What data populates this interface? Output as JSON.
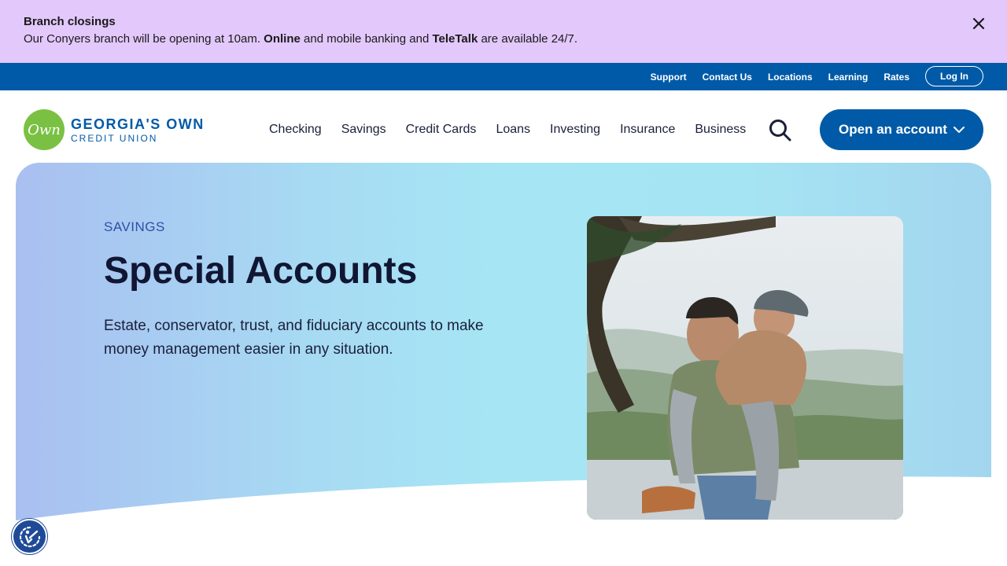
{
  "alert": {
    "title": "Branch closings",
    "message_prefix": "Our Conyers branch will be opening at 10am.",
    "online": "Online",
    "message_middle": "and mobile banking and",
    "teletalk": "TeleTalk",
    "message_suffix": "are available 24/7.",
    "close_icon": "close-icon"
  },
  "utility": {
    "links": [
      "Support",
      "Contact Us",
      "Locations",
      "Learning",
      "Rates"
    ],
    "login": "Log In"
  },
  "logo": {
    "mark": "Own",
    "name": "GEORGIA'S OWN",
    "subname": "CREDIT UNION"
  },
  "nav": {
    "items": [
      "Checking",
      "Savings",
      "Credit Cards",
      "Loans",
      "Investing",
      "Insurance",
      "Business"
    ],
    "search_icon": "search-icon",
    "open_account": "Open an account"
  },
  "hero": {
    "eyebrow": "SAVINGS",
    "title": "Special Accounts",
    "description": "Estate, conservator, trust, and fiduciary accounts to make money management easier in any situation."
  },
  "colors": {
    "alert_bg": "#e3c8fb",
    "brand_blue": "#005aa8",
    "logo_green": "#7ac143",
    "accessibility_blue": "#1f4a97"
  }
}
